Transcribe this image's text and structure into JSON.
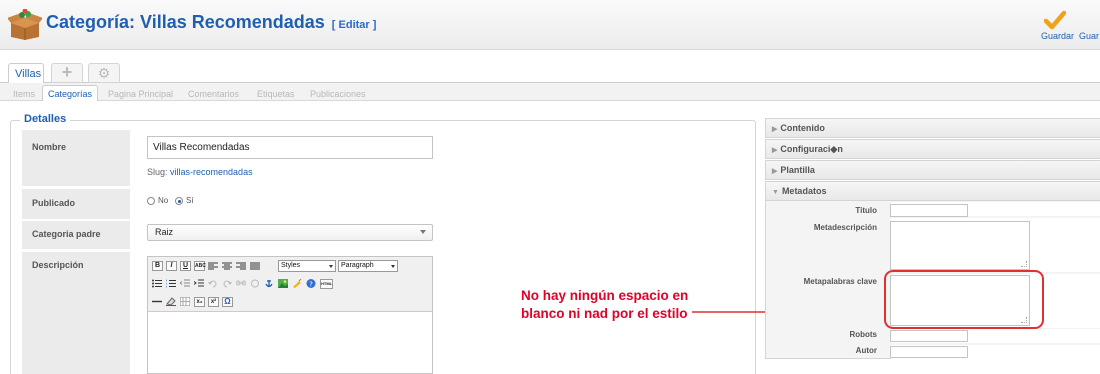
{
  "header": {
    "title": "Categoría: Villas Recomendadas",
    "edit_link": "[ Editar ]",
    "save_label": "Guardar",
    "save2_label": "Guar"
  },
  "tabs": {
    "top": [
      "Villas"
    ],
    "sub": [
      "Items",
      "Categorías",
      "Pagina Principal",
      "Comentarios",
      "Etiquetas",
      "Publicaciones"
    ]
  },
  "details": {
    "legend": "Detalles",
    "name_label": "Nombre",
    "name_value": "Villas Recomendadas",
    "slug_label": "Slug:",
    "slug_value": "villas-recomendadas",
    "published_label": "Publicado",
    "radio_no": "No",
    "radio_yes": "Sí",
    "published_value": "Sí",
    "parent_label": "Categoria padre",
    "parent_value": "Raiz",
    "description_label": "Descripción",
    "editor": {
      "styles": "Styles",
      "paragraph": "Paragraph",
      "bold": "B",
      "italic": "I",
      "underline": "U",
      "strike": "ABC",
      "html": "HTML",
      "omega": "Ω",
      "subscript": "x₂",
      "superscript": "x²"
    }
  },
  "annotation": {
    "line1": "No hay ningún espacio en",
    "line2": "blanco ni nad por el estilo",
    "color": "#e0002a"
  },
  "right_panel": {
    "accordions": [
      "Contenido",
      "Configuraci◆n",
      "Plantilla",
      "Metadatos"
    ],
    "meta_labels": {
      "title": "Titulo",
      "description": "Metadescripción",
      "keywords": "Metapalabras clave",
      "robots": "Robots",
      "author": "Autor"
    }
  },
  "colors": {
    "accent": "#1f5fb0",
    "label_cell": "#ebebeb",
    "annotation_red": "#e03030"
  }
}
